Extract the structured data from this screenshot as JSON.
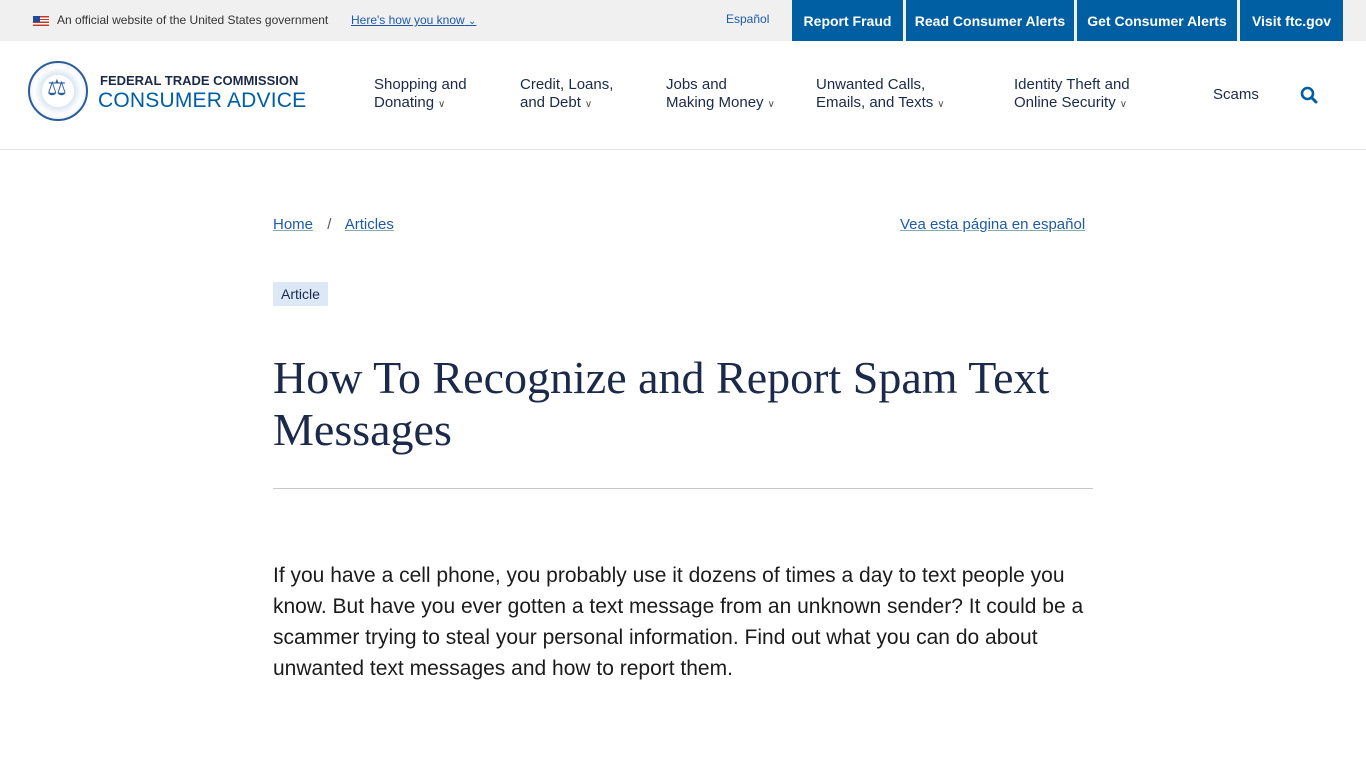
{
  "gov_banner": {
    "official": "An official website of the United States government",
    "how": "Here's how you know",
    "espanol": "Español"
  },
  "top_buttons": [
    "Report Fraud",
    "Read Consumer Alerts",
    "Get Consumer Alerts",
    "Visit ftc.gov"
  ],
  "logo": {
    "line1": "FEDERAL TRADE COMMISSION",
    "line2": "CONSUMER ADVICE"
  },
  "nav": [
    {
      "l1": "Shopping and",
      "l2": "Donating"
    },
    {
      "l1": "Credit, Loans,",
      "l2": "and Debt"
    },
    {
      "l1": "Jobs and",
      "l2": "Making Money"
    },
    {
      "l1": "Unwanted Calls,",
      "l2": "Emails, and Texts"
    },
    {
      "l1": "Identity Theft and",
      "l2": "Online Security"
    }
  ],
  "nav_scams": "Scams",
  "breadcrumb": {
    "home": "Home",
    "sep": "/",
    "articles": "Articles"
  },
  "spanish_link": "Vea esta página en español",
  "tag": "Article",
  "title": "How To Recognize and Report Spam Text Messages",
  "intro": "If you have a cell phone, you probably use it dozens of times a day to text people you know. But have you ever gotten a text message from an unknown sender? It could be a scammer trying to steal your personal information. Find out what you can do about unwanted text messages and how to report them.",
  "colors": {
    "primary": "#005ea2",
    "heading": "#1b2a4a"
  }
}
